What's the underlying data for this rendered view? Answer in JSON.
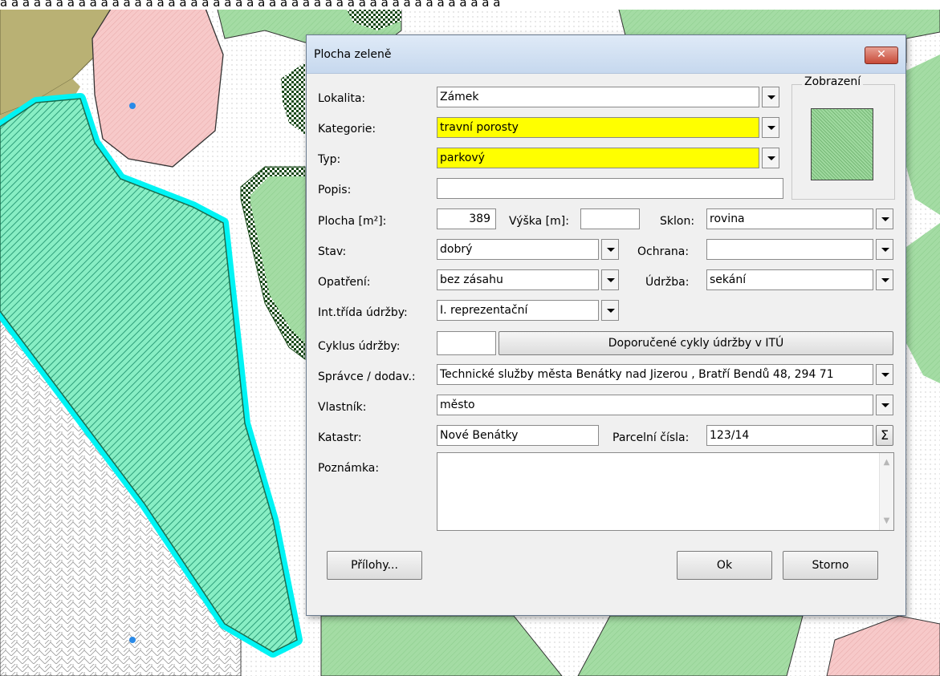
{
  "caption_fragment": "a a a a a a a a a a a a a a a a a a a a a a a a a a a a a a a a a a a a a a a a a a a a a",
  "dialog": {
    "title": "Plocha zeleně",
    "close_label": "✕",
    "preview_group_label": "Zobrazení",
    "preview_color": "#9fd99f",
    "fields": {
      "lokalita": {
        "label": "Lokalita:",
        "value": "Zámek"
      },
      "kategorie": {
        "label": "Kategorie:",
        "value": "travní porosty"
      },
      "typ": {
        "label": "Typ:",
        "value": "parkový"
      },
      "popis": {
        "label": "Popis:",
        "value": ""
      },
      "plocha": {
        "label": "Plocha [m²]:",
        "value": "389"
      },
      "vyska": {
        "label": "Výška [m]:",
        "value": ""
      },
      "sklon": {
        "label": "Sklon:",
        "value": "rovina"
      },
      "stav": {
        "label": "Stav:",
        "value": "dobrý"
      },
      "ochrana": {
        "label": "Ochrana:",
        "value": ""
      },
      "opatreni": {
        "label": "Opatření:",
        "value": "bez zásahu"
      },
      "udrzba": {
        "label": "Údržba:",
        "value": "sekání"
      },
      "int_trida": {
        "label": "Int.třída údržby:",
        "value": "I. reprezentační"
      },
      "cyklus": {
        "label": "Cyklus údržby:",
        "value": ""
      },
      "spravce": {
        "label": "Správce / dodav.:",
        "value": "Technické služby města Benátky nad Jizerou , Bratří Bendů 48, 294 71"
      },
      "vlastnik": {
        "label": "Vlastník:",
        "value": "město"
      },
      "katastr": {
        "label": "Katastr:",
        "value": "Nové Benátky"
      },
      "parcelni": {
        "label": "Parcelní čísla:",
        "value": "123/14"
      },
      "poznamka": {
        "label": "Poznámka:",
        "value": ""
      }
    },
    "buttons": {
      "doporucene": "Doporučené cykly údržby v ITÚ",
      "sum": "Σ",
      "prilohy": "Přílohy...",
      "ok": "Ok",
      "storno": "Storno"
    },
    "highlight_color": "#ffff00"
  }
}
